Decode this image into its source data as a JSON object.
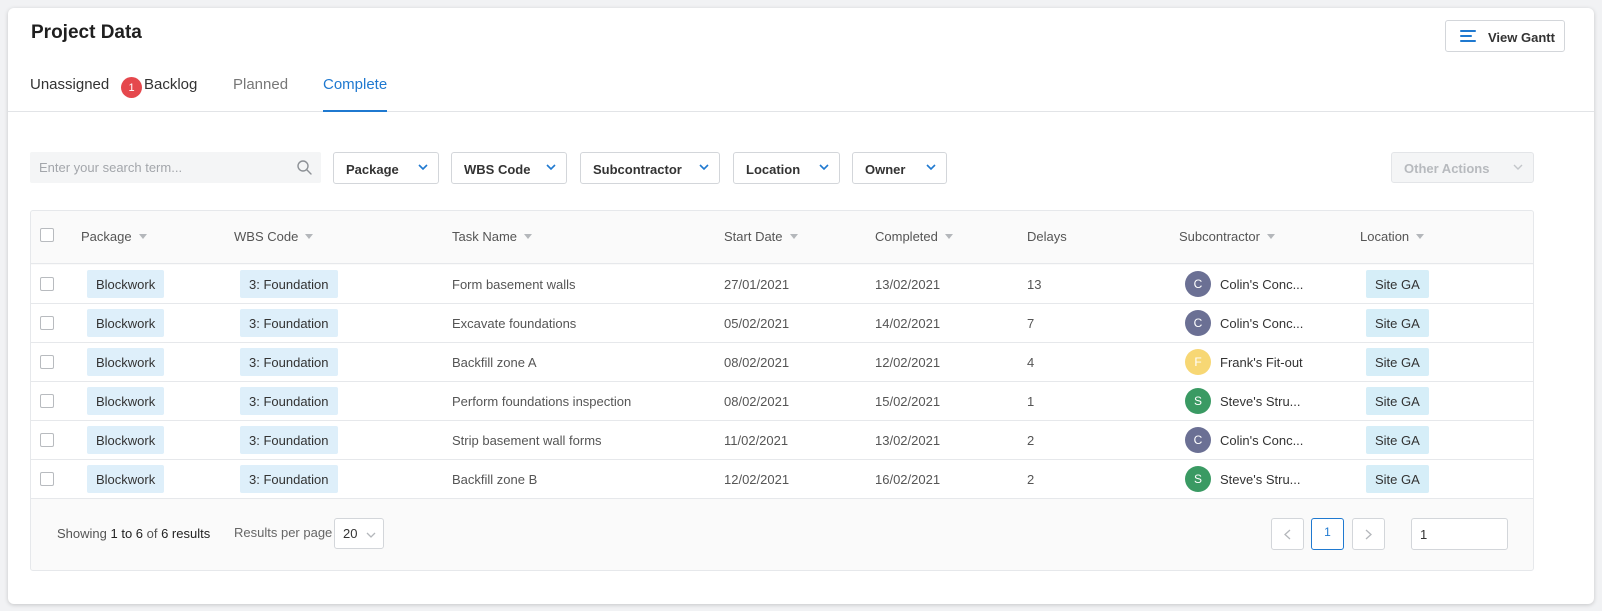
{
  "page": {
    "title": "Project Data",
    "view_gantt_label": "View Gantt",
    "colors": {
      "accent": "#1f79d0",
      "badge": "#e5484d",
      "tag_bg": "#deeffa"
    }
  },
  "tabs": [
    {
      "label": "Unassigned",
      "badge": "1",
      "state": "default"
    },
    {
      "label": "Backlog",
      "state": "default"
    },
    {
      "label": "Planned",
      "state": "muted"
    },
    {
      "label": "Complete",
      "state": "active"
    }
  ],
  "filters": {
    "search_placeholder": "Enter your search term...",
    "dropdowns": [
      "Package",
      "WBS Code",
      "Subcontractor",
      "Location",
      "Owner"
    ],
    "other_actions_label": "Other Actions"
  },
  "table": {
    "columns": [
      "Package",
      "WBS Code",
      "Task Name",
      "Start Date",
      "Completed",
      "Delays",
      "Subcontractor",
      "Location"
    ],
    "rows": [
      {
        "package": "Blockwork",
        "wbs": "3: Foundation",
        "task": "Form basement walls",
        "start": "27/01/2021",
        "completed": "13/02/2021",
        "delays": "13",
        "sub_initial": "C",
        "sub_color": "#6b7094",
        "subcontractor": "Colin's Conc...",
        "location": "Site GA"
      },
      {
        "package": "Blockwork",
        "wbs": "3: Foundation",
        "task": "Excavate foundations",
        "start": "05/02/2021",
        "completed": "14/02/2021",
        "delays": "7",
        "sub_initial": "C",
        "sub_color": "#6b7094",
        "subcontractor": "Colin's Conc...",
        "location": "Site GA"
      },
      {
        "package": "Blockwork",
        "wbs": "3: Foundation",
        "task": "Backfill zone A",
        "start": "08/02/2021",
        "completed": "12/02/2021",
        "delays": "4",
        "sub_initial": "F",
        "sub_color": "#f7d774",
        "subcontractor": "Frank's Fit-out",
        "location": "Site GA"
      },
      {
        "package": "Blockwork",
        "wbs": "3: Foundation",
        "task": "Perform foundations inspection",
        "start": "08/02/2021",
        "completed": "15/02/2021",
        "delays": "1",
        "sub_initial": "S",
        "sub_color": "#3a9a63",
        "subcontractor": "Steve's Stru...",
        "location": "Site GA"
      },
      {
        "package": "Blockwork",
        "wbs": "3: Foundation",
        "task": "Strip basement wall forms",
        "start": "11/02/2021",
        "completed": "13/02/2021",
        "delays": "2",
        "sub_initial": "C",
        "sub_color": "#6b7094",
        "subcontractor": "Colin's Conc...",
        "location": "Site GA"
      },
      {
        "package": "Blockwork",
        "wbs": "3: Foundation",
        "task": "Backfill zone B",
        "start": "12/02/2021",
        "completed": "16/02/2021",
        "delays": "2",
        "sub_initial": "S",
        "sub_color": "#3a9a63",
        "subcontractor": "Steve's Stru...",
        "location": "Site GA"
      }
    ]
  },
  "footer": {
    "showing_prefix": "Showing ",
    "range": "1 to 6",
    "of": " of ",
    "total": "6 results",
    "rpp_label": "Results per page",
    "rpp_value": "20",
    "current_page": "1",
    "page_input": "1"
  }
}
